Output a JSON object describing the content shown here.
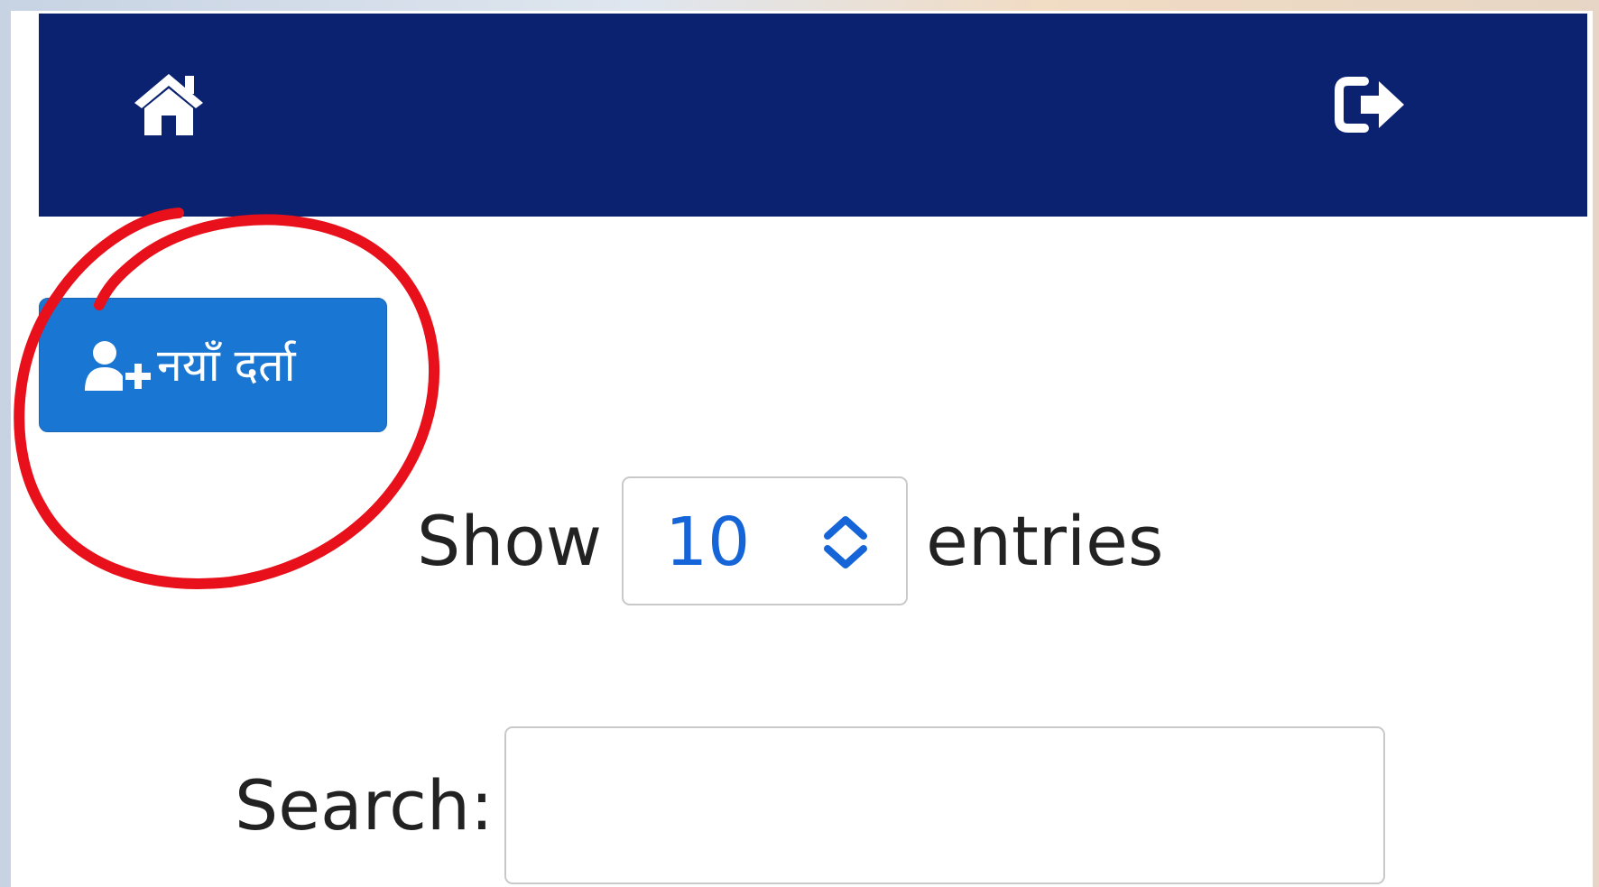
{
  "navbar": {
    "background_color": "#0b2270",
    "left_icon": "home-icon",
    "right_icon": "sign-out-icon"
  },
  "toolbar": {
    "add_button_label": "नयाँ दर्ता",
    "add_button_icon": "user-plus-icon",
    "add_button_color": "#1976d2"
  },
  "table_controls": {
    "length": {
      "prefix": "Show",
      "selected_value": "10",
      "suffix": "entries"
    },
    "search": {
      "label": "Search:",
      "value": ""
    }
  },
  "annotation": {
    "shape": "hand-drawn-circle",
    "color": "#e8101a",
    "target": "add-new-registration-button"
  }
}
